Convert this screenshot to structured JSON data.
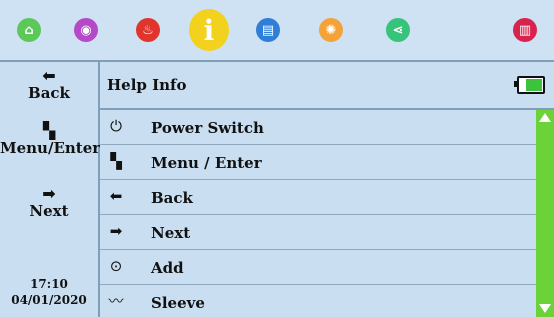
{
  "topbar": {
    "icons": [
      {
        "name": "home-icon",
        "color": "#5cc85a",
        "glyph": "⌂"
      },
      {
        "name": "power-circle-icon",
        "color": "#b44ac8",
        "glyph": "◉"
      },
      {
        "name": "heat-icon",
        "color": "#e0342c",
        "glyph": "♨"
      },
      {
        "name": "info-icon",
        "color": "#f2d21c",
        "glyph": "i"
      },
      {
        "name": "notes-icon",
        "color": "#2f7fd8",
        "glyph": "▤"
      },
      {
        "name": "sun-icon",
        "color": "#f4a23a",
        "glyph": "✺"
      },
      {
        "name": "share-icon",
        "color": "#36c47a",
        "glyph": "⋖"
      },
      {
        "name": "columns-icon",
        "color": "#d8244c",
        "glyph": "▥"
      }
    ]
  },
  "leftnav": {
    "back": {
      "label": "Back",
      "glyph": "⬅"
    },
    "menu": {
      "label": "Menu/Enter",
      "glyph": "▚"
    },
    "next": {
      "label": "Next",
      "glyph": "➡"
    }
  },
  "datetime": {
    "time": "17:10",
    "date": "04/01/2020"
  },
  "header": {
    "title": "Help Info"
  },
  "battery": {
    "level": 0.9,
    "color": "#3cc23c"
  },
  "list": {
    "items": [
      {
        "label": "Power Switch",
        "glyph": "⏻",
        "icon": "power-icon"
      },
      {
        "label": "Menu / Enter",
        "glyph": "▚",
        "icon": "menu-icon"
      },
      {
        "label": "Back",
        "glyph": "⬅",
        "icon": "back-arrow-icon"
      },
      {
        "label": "Next",
        "glyph": "➡",
        "icon": "next-arrow-icon"
      },
      {
        "label": "Add",
        "glyph": "⊙",
        "icon": "add-icon"
      },
      {
        "label": "Sleeve",
        "glyph": "〰",
        "icon": "sleeve-icon"
      }
    ]
  },
  "scrollbar": {
    "color": "#6bd23a"
  }
}
